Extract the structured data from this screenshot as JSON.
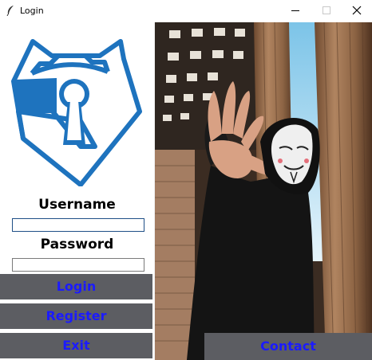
{
  "window": {
    "title": "Login"
  },
  "form": {
    "username_label": "Username",
    "username_value": "",
    "password_label": "Password",
    "password_value": ""
  },
  "buttons": {
    "login": "Login",
    "register": "Register",
    "exit": "Exit",
    "contact": "Contact"
  },
  "colors": {
    "logo_blue": "#1e73be",
    "button_bg": "#5c5d62",
    "button_text": "#1b1bff"
  },
  "icons": {
    "app": "feather-icon",
    "logo": "keyhole-shield-logo",
    "minimize": "minimize-icon",
    "maximize": "maximize-icon",
    "close": "close-icon"
  }
}
